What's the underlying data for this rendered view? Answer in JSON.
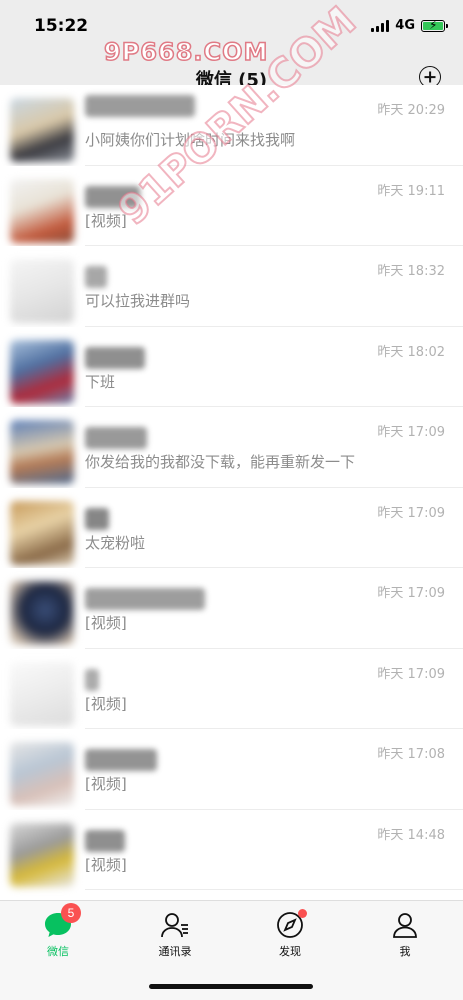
{
  "status": {
    "time": "15:22",
    "network": "4G"
  },
  "watermark_top": "9P668.COM",
  "watermark_diag": "91PORN.COM",
  "nav": {
    "title": "微信 (5)"
  },
  "chats": [
    {
      "time": "昨天 20:29",
      "preview": "小阿姨你们计划啥时间来找我啊"
    },
    {
      "time": "昨天 19:11",
      "preview": "[视频]"
    },
    {
      "time": "昨天 18:32",
      "preview": "可以拉我进群吗"
    },
    {
      "time": "昨天 18:02",
      "preview": "下班"
    },
    {
      "time": "昨天 17:09",
      "preview": "你发给我的我都没下载，能再重新发一下"
    },
    {
      "time": "昨天 17:09",
      "preview": "太宠粉啦"
    },
    {
      "time": "昨天 17:09",
      "preview": "[视频]"
    },
    {
      "time": "昨天 17:09",
      "preview": "[视频]"
    },
    {
      "time": "昨天 17:08",
      "preview": "[视频]"
    },
    {
      "time": "昨天 14:48",
      "preview": "[视频]"
    }
  ],
  "tabs": [
    {
      "label": "微信",
      "icon": "chat-bubble-icon",
      "badge": "5"
    },
    {
      "label": "通讯录",
      "icon": "contacts-icon"
    },
    {
      "label": "发现",
      "icon": "compass-icon"
    },
    {
      "label": "我",
      "icon": "person-icon"
    }
  ],
  "colors": {
    "accent": "#07c160",
    "badge": "#fa5151",
    "nav_bg": "#ededed",
    "tab_bg": "#f7f7f7"
  }
}
